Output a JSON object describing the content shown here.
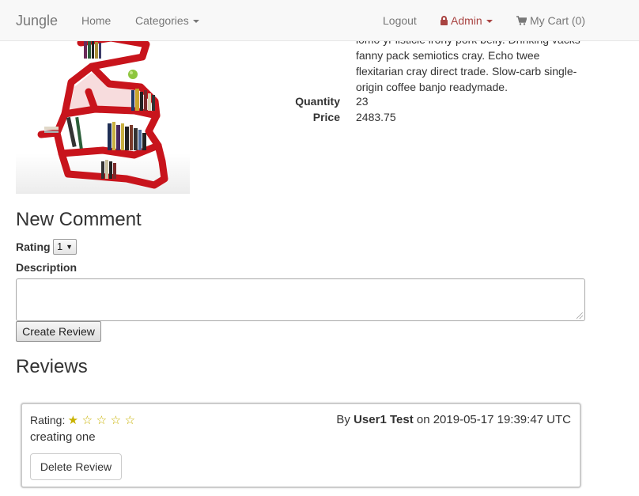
{
  "navbar": {
    "brand": "Jungle",
    "home": "Home",
    "categories": "Categories",
    "logout": "Logout",
    "admin": "Admin",
    "cart": "My Cart (0)"
  },
  "product": {
    "description_lines": [
      "lomo yr listicle irony pork belly. Drinking vacks",
      "fanny pack semiotics cray. Echo twee",
      "flexitarian cray direct trade. Slow-carb single-",
      "origin coffee banjo readymade."
    ],
    "quantity_label": "Quantity",
    "quantity": "23",
    "price_label": "Price",
    "price": "2483.75"
  },
  "comment_form": {
    "heading": "New Comment",
    "rating_label": "Rating",
    "rating_value": "1",
    "description_label": "Description",
    "submit_label": "Create Review"
  },
  "reviews": {
    "heading": "Reviews",
    "items": [
      {
        "rating_label": "Rating:",
        "rating": 1,
        "max_rating": 5,
        "by": "By",
        "author": "User1 Test",
        "on": "on",
        "date": "2019-05-17 19:39:47 UTC",
        "text": "creating one",
        "delete_label": "Delete Review"
      }
    ]
  },
  "colors": {
    "navbar_bg": "#f8f8f8",
    "admin": "#a94442",
    "star": "#c9b200",
    "bookshelf": "#c8141c"
  }
}
